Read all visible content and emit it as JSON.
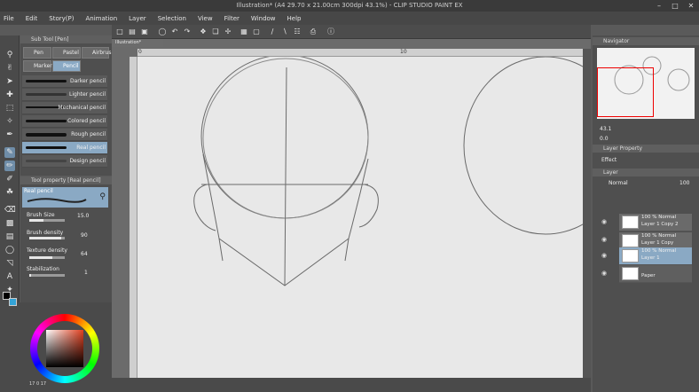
{
  "titlebar": {
    "title": "Illustration* (A4 29.70 x 21.00cm 300dpi 43.1%) - CLIP STUDIO PAINT EX"
  },
  "menu": [
    "File",
    "Edit",
    "Story(P)",
    "Animation",
    "Layer",
    "Selection",
    "View",
    "Filter",
    "Window",
    "Help"
  ],
  "document": {
    "tab": "Illustration*"
  },
  "ruler": {
    "mark0": "0",
    "mark10": "10"
  },
  "subtool": {
    "header": "Sub Tool [Pen]",
    "tabs": [
      "Pen",
      "Pastel",
      "Airbrush",
      "Marker",
      "Pencil"
    ],
    "brushes": [
      "Darker pencil",
      "Lighter pencil",
      "Mechanical pencil",
      "Colored pencil",
      "Rough pencil",
      "Real pencil",
      "Design pencil"
    ],
    "selected": "Real pencil"
  },
  "toolprop": {
    "header": "Tool property [Real pencil]",
    "preset": "Real pencil",
    "brush_size_label": "Brush Size",
    "brush_size": "15.0",
    "brush_density_label": "Brush density",
    "brush_density": "90",
    "texture_density_label": "Texture density",
    "texture_density": "64",
    "stabilization_label": "Stabilization",
    "stabilization": "1",
    "brush_size_level": 0.4,
    "brush_density_level": 0.9,
    "texture_density_level": 0.64,
    "stabilization_level": 0.05
  },
  "color": {
    "main": "#000000",
    "sub": "#33a3d6",
    "preview": "#aa5544",
    "readout1": "17",
    "readout2": "0",
    "readout3": "17"
  },
  "navigator": {
    "header": "Navigator",
    "zoom": "43.1",
    "angle": "0.0"
  },
  "layerprop": {
    "header": "Layer Property",
    "effect_label": "Effect"
  },
  "layers": {
    "header": "Layer",
    "blend": "Normal",
    "opacity": "100",
    "items": [
      {
        "mode": "100 % Normal",
        "name": "Layer 1 Copy 2"
      },
      {
        "mode": "100 % Normal",
        "name": "Layer 1 Copy"
      },
      {
        "mode": "100 % Normal",
        "name": "Layer 1"
      }
    ],
    "paper": "Paper"
  }
}
